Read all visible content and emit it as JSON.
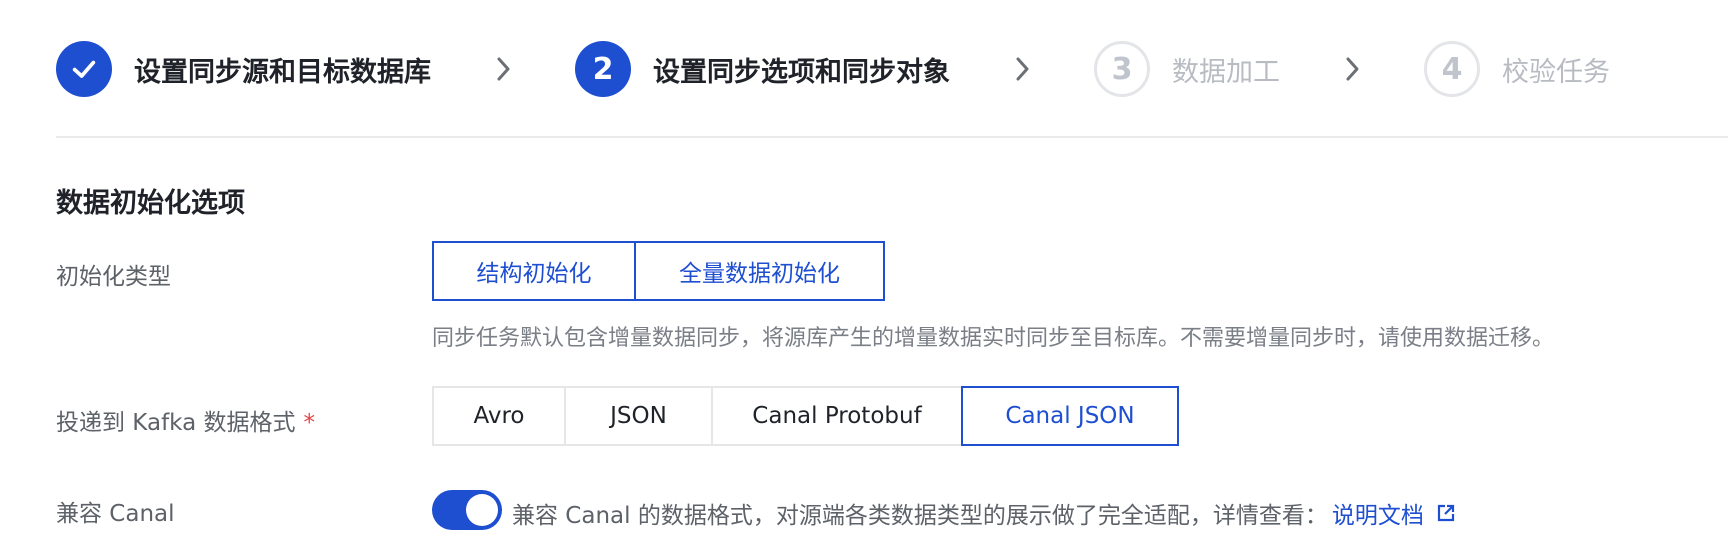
{
  "steps": [
    {
      "number": "1",
      "label": "设置同步源和目标数据库",
      "state": "done"
    },
    {
      "number": "2",
      "label": "设置同步选项和同步对象",
      "state": "active"
    },
    {
      "number": "3",
      "label": "数据加工",
      "state": "pending"
    },
    {
      "number": "4",
      "label": "校验任务",
      "state": "pending"
    }
  ],
  "section": {
    "title": "数据初始化选项"
  },
  "init_type": {
    "label": "初始化类型",
    "options": [
      "结构初始化",
      "全量数据初始化"
    ],
    "selected": [
      "结构初始化",
      "全量数据初始化"
    ],
    "hint": "同步任务默认包含增量数据同步，将源库产生的增量数据实时同步至目标库。不需要增量同步时，请使用数据迁移。"
  },
  "kafka_format": {
    "label": "投递到 Kafka 数据格式",
    "required_mark": "*",
    "options": [
      "Avro",
      "JSON",
      "Canal Protobuf",
      "Canal JSON"
    ],
    "selected": "Canal JSON"
  },
  "canal_compat": {
    "label": "兼容 Canal",
    "enabled": true,
    "description": "兼容 Canal 的数据格式，对源端各类数据类型的展示做了完全适配，详情查看：",
    "link_text": "说明文档"
  },
  "colors": {
    "primary": "#1f4fd1",
    "required": "#e54545",
    "pending": "#b8bcc2"
  }
}
